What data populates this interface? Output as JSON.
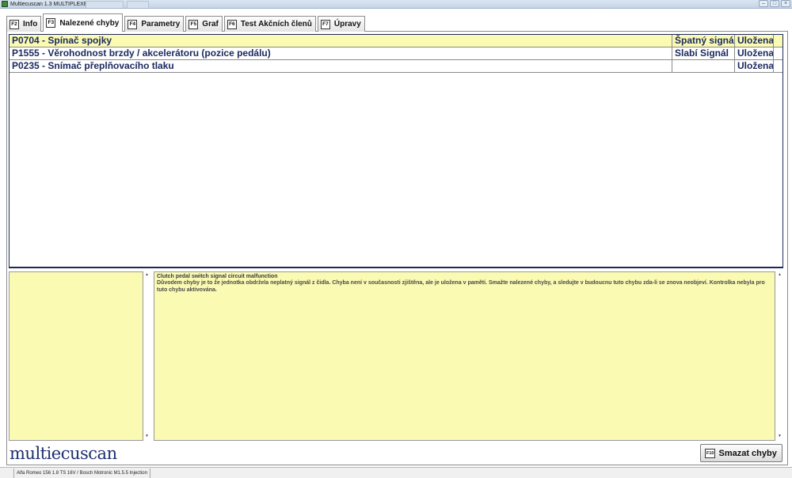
{
  "window": {
    "title": "Multiecuscan 1.3 MULTIPLEXED"
  },
  "tabs": [
    {
      "key": "F2",
      "label": "Info"
    },
    {
      "key": "F3",
      "label": "Nalezené chyby"
    },
    {
      "key": "F4",
      "label": "Parametry"
    },
    {
      "key": "F5",
      "label": "Graf"
    },
    {
      "key": "F6",
      "label": "Test Akčních členů"
    },
    {
      "key": "F7",
      "label": "Úpravy"
    }
  ],
  "errors": [
    {
      "description": "P0704 - Spínač spojky",
      "status": "Špatný signál",
      "memory": "Uložena"
    },
    {
      "description": "P1555 - Věrohodnost brzdy / akcelerátoru (pozice pedálu)",
      "status": "Slabí Signál",
      "memory": "Uložena"
    },
    {
      "description": "P0235 - Snímač přeplňovacího tlaku",
      "status": "",
      "memory": "Uložena"
    }
  ],
  "detail": {
    "title": "Clutch pedal switch signal circuit malfunction",
    "text": "Důvodem chyby je to že jednotka obdržela neplatný signál z čidla. Chyba není v současnosti zjištěna, ale je uložena v paměti. Smažte nalezené chyby, a sledujte v budoucnu tuto chybu zda-li se znova neobjeví. Kontrolka nebyla pro tuto chybu aktivována."
  },
  "footer": {
    "logo": "multiecuscan",
    "clear_key": "F10",
    "clear_label": "Smazat chyby"
  },
  "statusbar": {
    "vehicle": "Alfa Romeo 156 1.8 TS 16V / Bosch Motronic M1.5.5 Injection"
  },
  "colors": {
    "selected_row": "#fafab2",
    "panel_bg": "#fafab2",
    "text_blue": "#1c2a60"
  }
}
